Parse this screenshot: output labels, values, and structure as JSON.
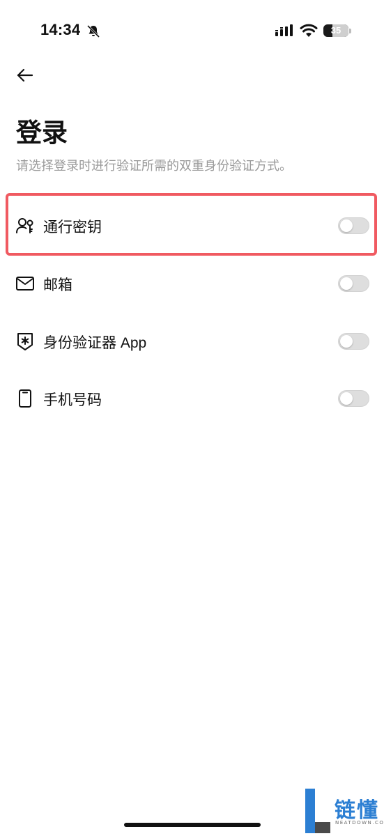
{
  "status_bar": {
    "time": "14:34",
    "battery_percent": "35",
    "battery_level": 0.35
  },
  "header": {
    "title": "登录",
    "subtitle": "请选择登录时进行验证所需的双重身份验证方式。"
  },
  "options": [
    {
      "label": "通行密钥",
      "icon": "passkey-icon",
      "enabled": false,
      "highlighted": true
    },
    {
      "label": "邮箱",
      "icon": "mail-icon",
      "enabled": false,
      "highlighted": false
    },
    {
      "label": "身份验证器 App",
      "icon": "authenticator-icon",
      "enabled": false,
      "highlighted": false
    },
    {
      "label": "手机号码",
      "icon": "phone-icon",
      "enabled": false,
      "highlighted": false
    }
  ],
  "watermark": {
    "text": "链懂",
    "sub": "NEATDOWN.COM"
  },
  "colors": {
    "highlight": "#f05a61",
    "toggle_off": "#dedede",
    "watermark_blue": "#2c7fd3"
  }
}
